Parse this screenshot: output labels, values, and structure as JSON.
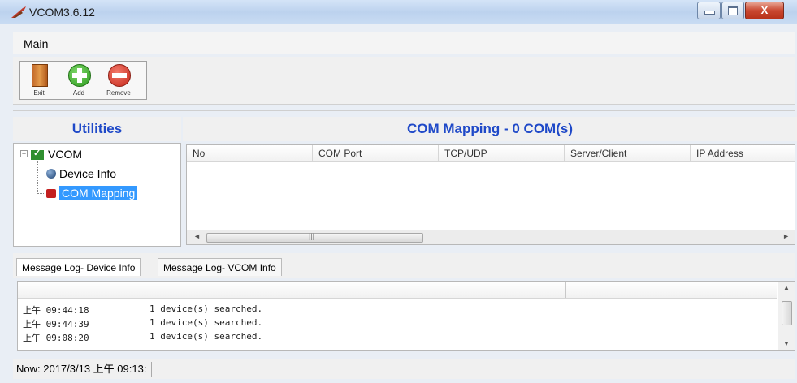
{
  "window": {
    "title": "VCOM3.6.12",
    "close_glyph": "X"
  },
  "menu": {
    "main": "Main"
  },
  "toolbar": {
    "exit_label": "Exit",
    "add_label": "Add",
    "remove_label": "Remove"
  },
  "left_panel": {
    "header": "Utilities",
    "tree": {
      "root": "VCOM",
      "children": [
        "Device Info",
        "COM Mapping"
      ],
      "selected": "COM Mapping"
    }
  },
  "right_panel": {
    "header": "COM Mapping - 0 COM(s)",
    "columns": [
      "No",
      "COM Port",
      "TCP/UDP",
      "Server/Client",
      "IP Address"
    ],
    "scroll_grip": "|||"
  },
  "log_tabs": [
    "Message Log- Device Info",
    "Message Log- VCOM Info"
  ],
  "log_entries": [
    {
      "time": "上午 09:44:18",
      "message": "1 device(s) searched."
    },
    {
      "time": "上午 09:44:39",
      "message": "1 device(s) searched."
    },
    {
      "time": "上午 09:08:20",
      "message": "1 device(s) searched."
    }
  ],
  "status": {
    "text": "Now: 2017/3/13 上午 09:13:"
  },
  "icons": {
    "app": "vcom-app-icon",
    "exit": "door-exit-icon",
    "add": "plus-circle-icon",
    "remove": "minus-circle-icon",
    "vcom": "checkmark-icon",
    "device_info": "globe-icon",
    "com_mapping": "plug-icon"
  },
  "colors": {
    "header_text": "#1f49c8",
    "selection": "#3399ff",
    "close_button": "#c94730"
  }
}
